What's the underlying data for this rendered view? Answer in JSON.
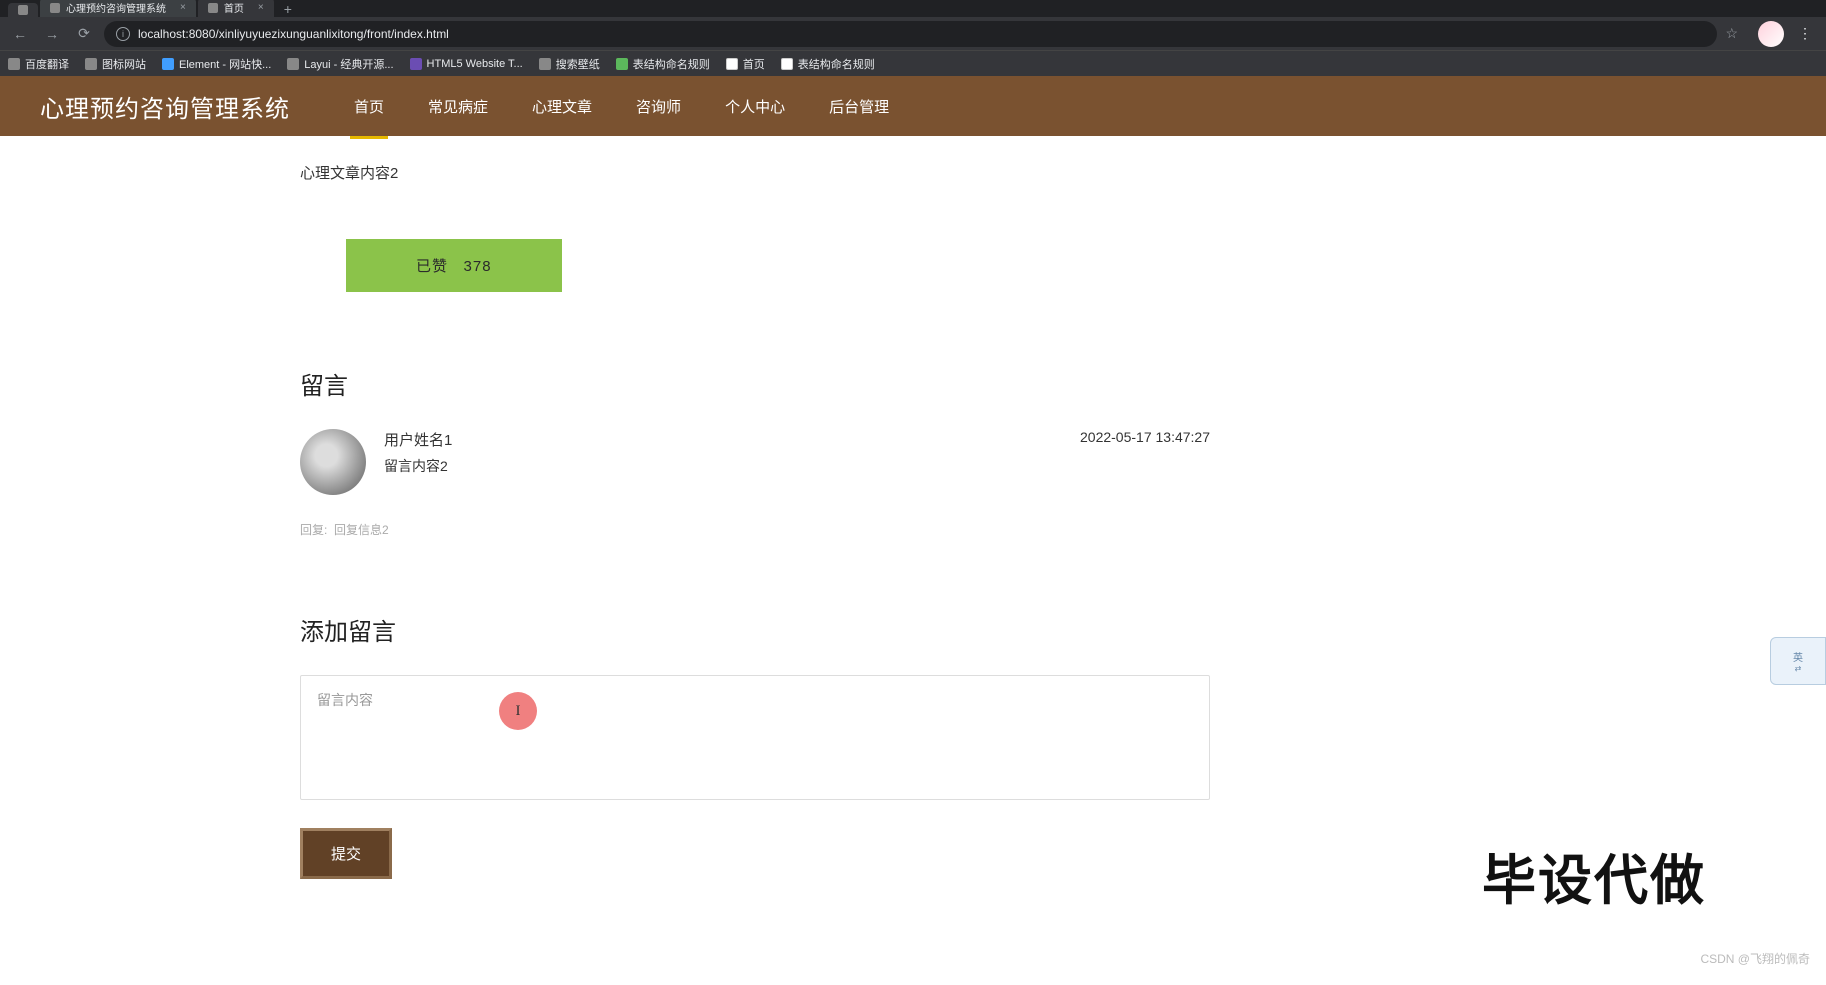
{
  "browser": {
    "tabs": [
      {
        "title": "心理预约咨询管理系统",
        "active": true
      },
      {
        "title": "首页",
        "active": false
      }
    ],
    "url": "localhost:8080/xinliyuyuezixunguanlixitong/front/index.html",
    "bookmarks": [
      {
        "label": "百度翻译"
      },
      {
        "label": "图标网站"
      },
      {
        "label": "Element - 网站快..."
      },
      {
        "label": "Layui - 经典开源..."
      },
      {
        "label": "HTML5 Website T..."
      },
      {
        "label": "搜索壁纸"
      },
      {
        "label": "表结构命名规则"
      },
      {
        "label": "首页"
      },
      {
        "label": "表结构命名规则"
      }
    ]
  },
  "header": {
    "logo": "心理预约咨询管理系统",
    "nav": [
      {
        "label": "首页",
        "active": true
      },
      {
        "label": "常见病症",
        "active": false
      },
      {
        "label": "心理文章",
        "active": false
      },
      {
        "label": "咨询师",
        "active": false
      },
      {
        "label": "个人中心",
        "active": false
      },
      {
        "label": "后台管理",
        "active": false
      }
    ]
  },
  "article": {
    "content": "心理文章内容2",
    "like_label": "已赞",
    "like_count": "378"
  },
  "comments": {
    "title": "留言",
    "items": [
      {
        "username": "用户姓名1",
        "text": "留言内容2",
        "time": "2022-05-17 13:47:27",
        "reply_label": "回复:",
        "reply_text": "回复信息2"
      }
    ]
  },
  "add_comment": {
    "title": "添加留言",
    "placeholder": "留言内容",
    "submit_label": "提交"
  },
  "overlay": {
    "watermark": "毕设代做",
    "csdn": "CSDN @飞翔的佩奇",
    "ime": "英",
    "cursor_char": "I"
  }
}
